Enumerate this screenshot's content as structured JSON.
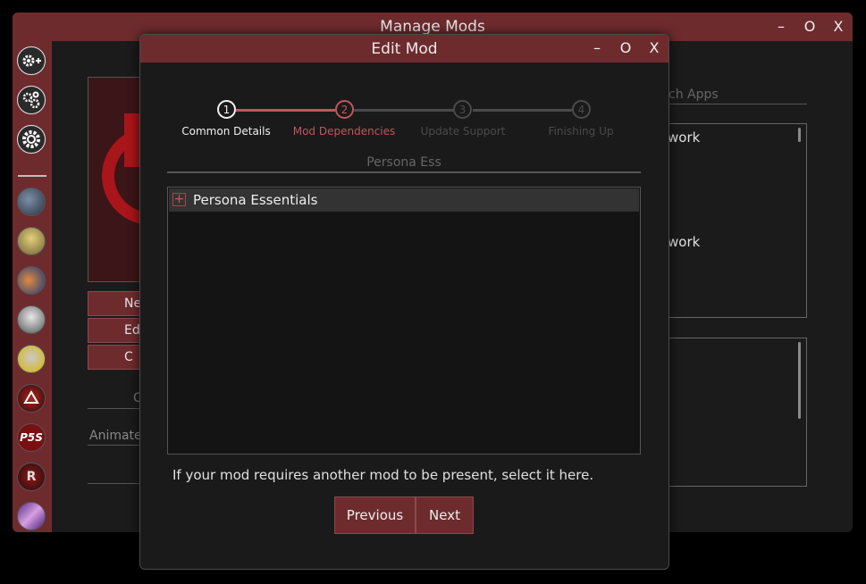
{
  "main_window": {
    "title": "Manage Mods",
    "controls": {
      "minimize": "–",
      "maximize": "O",
      "close": "X"
    },
    "mod_actions": [
      "Ne",
      "Ed",
      "C"
    ],
    "bg_texts": {
      "filter_partial": "C",
      "animate_partial": "Animate"
    },
    "right_panel": {
      "search_placeholder": "arch Apps",
      "items": [
        "work",
        "work"
      ]
    }
  },
  "sidebar": {
    "icons": [
      "add-mod-gear-icon",
      "manage-gears-icon",
      "settings-gear-icon"
    ],
    "avatars": [
      "p4-character",
      "p4-character-blonde",
      "p3-character",
      "p4-character-white",
      "p4-character-glasses",
      "p5r-logo",
      "p5s-logo",
      "r-logo",
      "purple-art"
    ],
    "badges": {
      "p5s": "P5S",
      "r": "R"
    }
  },
  "dialog": {
    "title": "Edit Mod",
    "controls": {
      "minimize": "–",
      "maximize": "O",
      "close": "X"
    },
    "steps": [
      {
        "number": "1",
        "label": "Common Details",
        "state": "completed"
      },
      {
        "number": "2",
        "label": "Mod Dependencies",
        "state": "active"
      },
      {
        "number": "3",
        "label": "Update Support",
        "state": "pending"
      },
      {
        "number": "4",
        "label": "Finishing Up",
        "state": "pending"
      }
    ],
    "filter_text": "Persona Ess",
    "dependency_list": [
      {
        "expander": "+",
        "label": "Persona Essentials"
      }
    ],
    "hint": "If your mod requires another mod to be present, select it here.",
    "buttons": {
      "previous": "Previous",
      "next": "Next"
    }
  },
  "colors": {
    "accent": "#6e2b2e",
    "accent_light": "#c0575c",
    "window_bg": "#1b1b1b",
    "inactive": "#4a4a4a"
  }
}
